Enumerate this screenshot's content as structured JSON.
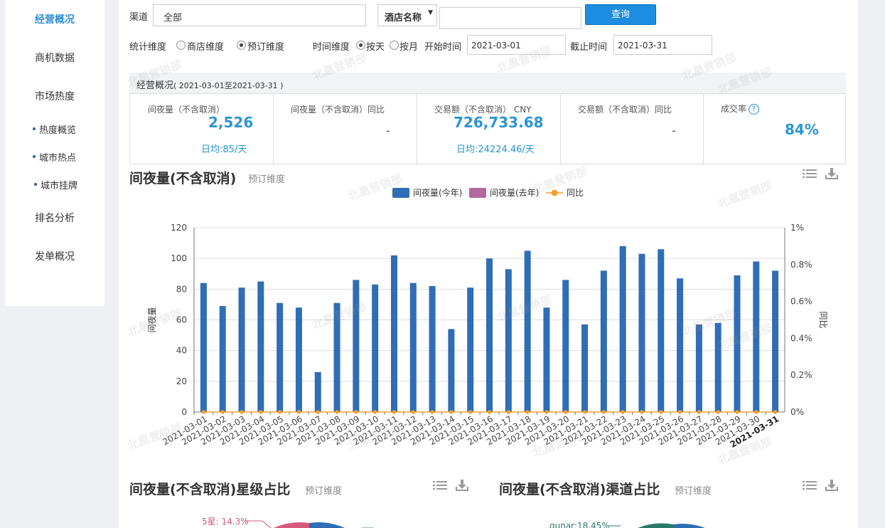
{
  "sidebar": {
    "items": [
      {
        "label": "经营概况",
        "active": true
      },
      {
        "label": "商机数据"
      },
      {
        "label": "市场热度"
      },
      {
        "label": "热度概览",
        "sub": true
      },
      {
        "label": "城市热点",
        "sub": true
      },
      {
        "label": "城市挂牌",
        "sub": true
      },
      {
        "label": "排名分析"
      },
      {
        "label": "发单概况"
      }
    ]
  },
  "filters": {
    "channel_label": "渠道",
    "channel_value": "全部",
    "hotel_select": "酒店名称",
    "hotel_input": "",
    "query_button": "查询",
    "stat_dim_label": "统计维度",
    "stat_dim_options": [
      "商店维度",
      "预订维度"
    ],
    "time_dim_label": "时间维度",
    "time_dim_options": [
      "按天",
      "按月"
    ],
    "start_label": "开始时间",
    "start_value": "2021-03-01",
    "end_label": "截止时间",
    "end_value": "2021-03-31"
  },
  "overview": {
    "title": "经营概况",
    "range": "( 2021-03-01至2021-03-31 )",
    "kpis": [
      {
        "label": "间夜量（不含取消）",
        "value": "2,526",
        "sub": "日均:85/天"
      },
      {
        "label": "间夜量（不含取消）同比",
        "value": "-"
      },
      {
        "label": "交易额（不含取消） CNY",
        "value": "726,733.68",
        "sub": "日均:24224.46/天"
      },
      {
        "label": "交易额（不含取消）同比",
        "value": "-"
      },
      {
        "label": "成交率",
        "value": "84%",
        "help": "?"
      }
    ]
  },
  "main_chart": {
    "title": "间夜量(不含取消)",
    "subtitle": "预订维度"
  },
  "chart_data": {
    "type": "bar",
    "categories": [
      "2021-03-01",
      "2021-03-02",
      "2021-03-03",
      "2021-03-04",
      "2021-03-05",
      "2021-03-06",
      "2021-03-07",
      "2021-03-08",
      "2021-03-09",
      "2021-03-10",
      "2021-03-11",
      "2021-03-12",
      "2021-03-13",
      "2021-03-14",
      "2021-03-15",
      "2021-03-16",
      "2021-03-17",
      "2021-03-18",
      "2021-03-19",
      "2021-03-20",
      "2021-03-21",
      "2021-03-22",
      "2021-03-23",
      "2021-03-24",
      "2021-03-25",
      "2021-03-26",
      "2021-03-27",
      "2021-03-28",
      "2021-03-29",
      "2021-03-30",
      "2021-03-31"
    ],
    "series": [
      {
        "name": "间夜量(今年)",
        "type": "bar",
        "axis": "left",
        "color": "#2f6db5",
        "values": [
          84,
          69,
          81,
          85,
          71,
          68,
          26,
          71,
          86,
          83,
          102,
          84,
          82,
          54,
          81,
          100,
          93,
          105,
          68,
          86,
          57,
          92,
          108,
          103,
          106,
          87,
          57,
          58,
          89,
          98,
          92
        ]
      },
      {
        "name": "间夜量(去年)",
        "type": "bar",
        "axis": "left",
        "color": "#b0689e",
        "values": []
      },
      {
        "name": "同比",
        "type": "line",
        "axis": "right",
        "color": "#f0a030",
        "values": [
          0,
          0,
          0,
          0,
          0,
          0,
          0,
          0,
          0,
          0,
          0,
          0,
          0,
          0,
          0,
          0,
          0,
          0,
          0,
          0,
          0,
          0,
          0,
          0,
          0,
          0,
          0,
          0,
          0,
          0,
          0
        ]
      }
    ],
    "ylabel": "间夜量",
    "y2label": "同比",
    "ylim": [
      0,
      120
    ],
    "yticks": [
      0,
      20,
      40,
      60,
      80,
      100,
      120
    ],
    "y2lim": [
      0,
      1
    ],
    "y2ticks": [
      "0%",
      "0.2%",
      "0.4%",
      "0.6%",
      "0.8%",
      "1%"
    ],
    "legend_position": "top-center",
    "grid": true
  },
  "star_chart": {
    "title": "间夜量(不含取消)星级占比",
    "subtitle": "预订维度",
    "label": "5星: 14.3%"
  },
  "channel_chart": {
    "title": "间夜量(不含取消)渠道占比",
    "subtitle": "预订维度",
    "label": "qunar:18.45%"
  },
  "watermark": "北凰营销部",
  "icons": {
    "list": "list-icon",
    "download": "download-icon",
    "dropdown": "caret-down-icon",
    "help": "question-icon"
  }
}
